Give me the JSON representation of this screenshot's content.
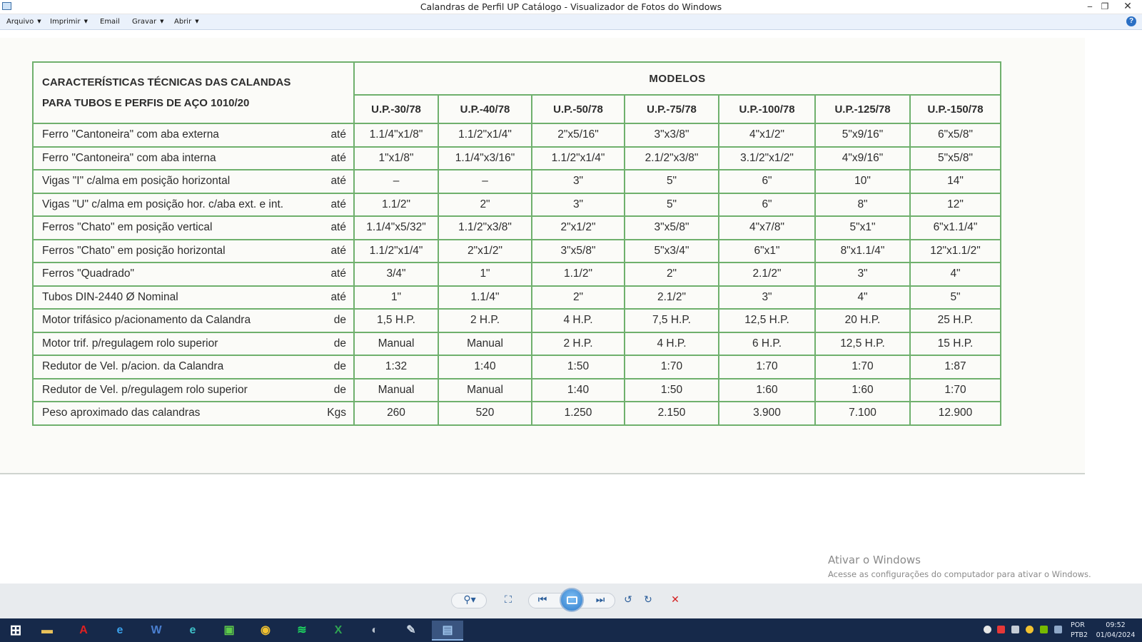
{
  "window": {
    "title": "Calandras de Perfil UP Catálogo - Visualizador de Fotos do Windows",
    "minimize": "‒",
    "restore": "❐",
    "close": "✕"
  },
  "menu": {
    "items": [
      {
        "label": "Arquivo",
        "has_caret": true
      },
      {
        "label": "Imprimir",
        "has_caret": true
      },
      {
        "label": "Email",
        "has_caret": false
      },
      {
        "label": "Gravar",
        "has_caret": true
      },
      {
        "label": "Abrir",
        "has_caret": true
      }
    ],
    "help": "?"
  },
  "table": {
    "title_line1": "CARACTERÍSTICAS TÉCNICAS DAS CALANDAS",
    "title_line2": "PARA TUBOS E PERFIS DE AÇO 1010/20",
    "modelos": "MODELOS",
    "models": [
      "U.P.-30/78",
      "U.P.-40/78",
      "U.P.-50/78",
      "U.P.-75/78",
      "U.P.-100/78",
      "U.P.-125/78",
      "U.P.-150/78"
    ],
    "rows": [
      {
        "label": "Ferro \"Cantoneira\" com aba externa",
        "unit": "até",
        "values": [
          "1.1/4\"x1/8\"",
          "1.1/2\"x1/4\"",
          "2\"x5/16\"",
          "3\"x3/8\"",
          "4\"x1/2\"",
          "5\"x9/16\"",
          "6\"x5/8\""
        ]
      },
      {
        "label": "Ferro \"Cantoneira\" com aba interna",
        "unit": "até",
        "values": [
          "1\"x1/8\"",
          "1.1/4\"x3/16\"",
          "1.1/2\"x1/4\"",
          "2.1/2\"x3/8\"",
          "3.1/2\"x1/2\"",
          "4\"x9/16\"",
          "5\"x5/8\""
        ]
      },
      {
        "label": "Vigas \"I\" c/alma em posição horizontal",
        "unit": "até",
        "values": [
          "–",
          "–",
          "3\"",
          "5\"",
          "6\"",
          "10\"",
          "14\""
        ]
      },
      {
        "label": "Vigas \"U\" c/alma em posição hor. c/aba ext. e int.",
        "unit": "até",
        "values": [
          "1.1/2\"",
          "2\"",
          "3\"",
          "5\"",
          "6\"",
          "8\"",
          "12\""
        ]
      },
      {
        "label": "Ferros \"Chato\" em posição vertical",
        "unit": "até",
        "values": [
          "1.1/4\"x5/32\"",
          "1.1/2\"x3/8\"",
          "2\"x1/2\"",
          "3\"x5/8\"",
          "4\"x7/8\"",
          "5\"x1\"",
          "6\"x1.1/4\""
        ]
      },
      {
        "label": "Ferros \"Chato\" em posição horizontal",
        "unit": "até",
        "values": [
          "1.1/2\"x1/4\"",
          "2\"x1/2\"",
          "3\"x5/8\"",
          "5\"x3/4\"",
          "6\"x1\"",
          "8\"x1.1/4\"",
          "12\"x1.1/2\""
        ]
      },
      {
        "label": "Ferros \"Quadrado\"",
        "unit": "até",
        "values": [
          "3/4\"",
          "1\"",
          "1.1/2\"",
          "2\"",
          "2.1/2\"",
          "3\"",
          "4\""
        ]
      },
      {
        "label": "Tubos DIN-2440 Ø Nominal",
        "unit": "até",
        "values": [
          "1\"",
          "1.1/4\"",
          "2\"",
          "2.1/2\"",
          "3\"",
          "4\"",
          "5\""
        ]
      },
      {
        "label": "Motor trifásico p/acionamento da Calandra",
        "unit": "de",
        "values": [
          "1,5 H.P.",
          "2 H.P.",
          "4 H.P.",
          "7,5 H.P.",
          "12,5 H.P.",
          "20 H.P.",
          "25 H.P."
        ]
      },
      {
        "label": "Motor trif. p/regulagem rolo superior",
        "unit": "de",
        "values": [
          "Manual",
          "Manual",
          "2 H.P.",
          "4 H.P.",
          "6 H.P.",
          "12,5 H.P.",
          "15 H.P."
        ]
      },
      {
        "label": "Redutor de Vel. p/acion. da Calandra",
        "unit": "de",
        "values": [
          "1:32",
          "1:40",
          "1:50",
          "1:70",
          "1:70",
          "1:70",
          "1:87"
        ]
      },
      {
        "label": "Redutor de Vel. p/regulagem rolo superior",
        "unit": "de",
        "values": [
          "Manual",
          "Manual",
          "1:40",
          "1:50",
          "1:60",
          "1:60",
          "1:70"
        ]
      },
      {
        "label": "Peso aproximado das calandras",
        "unit": "Kgs",
        "values": [
          "260",
          "520",
          "1.250",
          "2.150",
          "3.900",
          "7.100",
          "12.900"
        ]
      }
    ]
  },
  "watermark": {
    "line1": "Ativar o Windows",
    "line2": "Acesse as configurações do computador para ativar o Windows."
  },
  "toolbar": {
    "zoom": "⚲▾",
    "fit": "⛶",
    "previous": "⏮",
    "next": "⏭",
    "rotate_left": "↺",
    "rotate_right": "↻",
    "delete": "✕"
  },
  "taskbar": {
    "start": "⊞",
    "apps": [
      {
        "name": "file-explorer",
        "glyph": "▬",
        "color": "#e8c15a"
      },
      {
        "name": "acrobat",
        "glyph": "A",
        "color": "#e02020"
      },
      {
        "name": "internet-explorer",
        "glyph": "e",
        "color": "#3aa0ea"
      },
      {
        "name": "word",
        "glyph": "W",
        "color": "#4a7fd0"
      },
      {
        "name": "edge",
        "glyph": "e",
        "color": "#3ec0c8"
      },
      {
        "name": "store",
        "glyph": "▣",
        "color": "#5ecb4a"
      },
      {
        "name": "chrome",
        "glyph": "◉",
        "color": "#f2c230"
      },
      {
        "name": "spotify",
        "glyph": "≋",
        "color": "#1ed760"
      },
      {
        "name": "excel",
        "glyph": "X",
        "color": "#2fa552"
      },
      {
        "name": "media",
        "glyph": "◐",
        "color": "#b7c1cc"
      },
      {
        "name": "paint",
        "glyph": "✎",
        "color": "#c9d4e0"
      },
      {
        "name": "photo-viewer",
        "glyph": "▤",
        "color": "#9fc6ee"
      }
    ],
    "lang_line1": "POR",
    "lang_line2": "PTB2",
    "time": "09:52",
    "date": "01/04/2024"
  }
}
